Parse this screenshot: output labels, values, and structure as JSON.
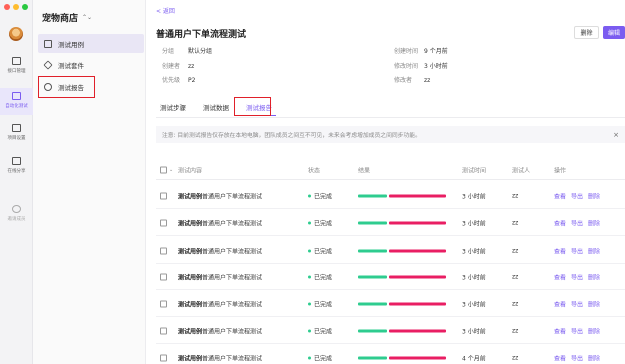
{
  "rail": {
    "items": [
      {
        "label": "接口管理"
      },
      {
        "label": "自动化测试"
      },
      {
        "label": "项目设置"
      },
      {
        "label": "在线分享"
      },
      {
        "label": "邀请成员"
      }
    ]
  },
  "sidebar": {
    "workspace": "宠物商店",
    "items": [
      {
        "label": "测试用例"
      },
      {
        "label": "测试套件"
      },
      {
        "label": "测试报告"
      }
    ]
  },
  "main": {
    "back": "< 返回",
    "title": "普通用户下单流程测试",
    "delete_label": "删除",
    "edit_label": "编辑",
    "meta": {
      "group_k": "分组",
      "group_v": "默认分组",
      "creator_k": "创建者",
      "creator_v": "zz",
      "priority_k": "优先级",
      "priority_v": "P2",
      "created_k": "创建时间",
      "created_v": "9 个月前",
      "modified_k": "修改时间",
      "modified_v": "3 小时前",
      "modifier_k": "修改者",
      "modifier_v": "zz"
    },
    "tabs": [
      {
        "label": "测试步骤"
      },
      {
        "label": "测试数据"
      },
      {
        "label": "测试报告"
      }
    ],
    "notice": "注意: 目前测试报告仅存放在本地电脑，团队成员之间互不可见，未来会考虑增加成员之间同步功能。",
    "notice_close": "×",
    "headers": {
      "content": "测试内容",
      "status": "状态",
      "result": "结果",
      "time": "测试时间",
      "tester": "测试人",
      "ops": "操作"
    },
    "rows": [
      {
        "prefix": "测试用例",
        "name": "普通用户下单流程测试",
        "status": "已完成",
        "time": "3 小时前",
        "tester": "zz"
      },
      {
        "prefix": "测试用例",
        "name": "普通用户下单流程测试",
        "status": "已完成",
        "time": "3 小时前",
        "tester": "zz"
      },
      {
        "prefix": "测试用例",
        "name": "普通用户下单流程测试",
        "status": "已完成",
        "time": "3 小时前",
        "tester": "zz"
      },
      {
        "prefix": "测试用例",
        "name": "普通用户下单流程测试",
        "status": "已完成",
        "time": "3 小时前",
        "tester": "zz"
      },
      {
        "prefix": "测试用例",
        "name": "普通用户下单流程测试",
        "status": "已完成",
        "time": "3 小时前",
        "tester": "zz"
      },
      {
        "prefix": "测试用例",
        "name": "普通用户下单流程测试",
        "status": "已完成",
        "time": "3 小时前",
        "tester": "zz"
      },
      {
        "prefix": "测试用例",
        "name": "普通用户下单流程测试",
        "status": "已完成",
        "time": "4 个月前",
        "tester": "zz"
      }
    ],
    "op_view": "查看",
    "op_export": "导出",
    "op_delete": "删除"
  },
  "colors": {
    "accent": "#7b5cf0",
    "success": "#2ecc8f",
    "fail": "#e91e63",
    "highlight": "#e0202a"
  }
}
